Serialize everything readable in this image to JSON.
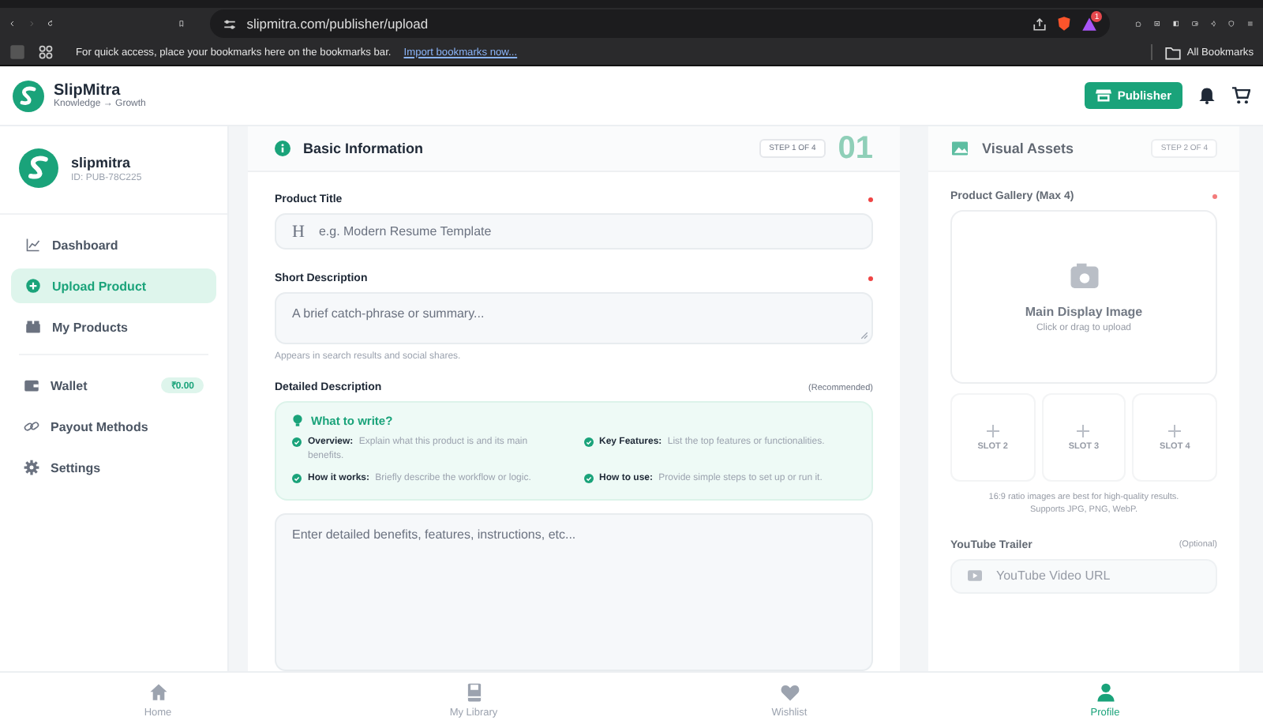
{
  "browser": {
    "url": "slipmitra.com/publisher/upload",
    "rewards_badge": "1",
    "bookmarks_hint": "For quick access, place your bookmarks here on the bookmarks bar.",
    "import_link": "Import bookmarks now...",
    "all_bookmarks": "All Bookmarks"
  },
  "header": {
    "brand": "SlipMitra",
    "tagline": "Knowledge → Growth",
    "publisher_button": "Publisher"
  },
  "profile": {
    "name": "slipmitra",
    "id": "ID: PUB-78C225"
  },
  "nav_groups": [
    [
      {
        "label": "Dashboard",
        "kind": "chart",
        "selected": false
      },
      {
        "label": "Upload Product",
        "kind": "plus",
        "selected": true
      },
      {
        "label": "My Products",
        "kind": "box",
        "selected": false
      }
    ],
    [
      {
        "label": "Wallet",
        "kind": "wallet",
        "selected": false,
        "badge": "₹0.00"
      },
      {
        "label": "Payout Methods",
        "kind": "link",
        "selected": false
      },
      {
        "label": "Settings",
        "kind": "gear",
        "selected": false
      }
    ]
  ],
  "basic_info": {
    "title": "Basic Information",
    "step": "STEP 1 OF 4",
    "step_number": "01",
    "product_title": {
      "label": "Product Title",
      "required": true,
      "icon": "H",
      "placeholder": "e.g. Modern Resume Template"
    },
    "short_description": {
      "label": "Short Description",
      "required": true,
      "placeholder": "A brief catch-phrase or summary...",
      "hint": "Appears in search results and social shares."
    },
    "detailed_description": {
      "label": "Detailed Description",
      "note": "(Recommended)",
      "guide_title": "What to write?",
      "guide_items": [
        {
          "term": "Overview:",
          "text": "Explain what this product is and its main benefits."
        },
        {
          "term": "Key Features:",
          "text": "List the top features or functionalities."
        },
        {
          "term": "How it works:",
          "text": "Briefly describe the workflow or logic."
        },
        {
          "term": "How to use:",
          "text": "Provide simple steps to set up or run it."
        }
      ],
      "placeholder": "Enter detailed benefits, features, instructions, etc..."
    }
  },
  "visual_assets": {
    "title": "Visual Assets",
    "step": "STEP 2 OF 4",
    "disabled": true,
    "gallery_label": "Product Gallery (Max 4)",
    "gallery_required": true,
    "main_image_title": "Main Display Image",
    "main_image_hint": "Click or drag to upload",
    "slots": [
      "SLOT 2",
      "SLOT 3",
      "SLOT 4"
    ],
    "ratio_note": "16:9 ratio images are best for high-quality results.",
    "formats_note": "Supports JPG, PNG, WebP.",
    "trailer_label": "YouTube Trailer",
    "trailer_note": "(Optional)",
    "trailer_placeholder": "YouTube Video URL"
  },
  "bottom_nav": [
    {
      "label": "Home",
      "kind": "home",
      "selected": false
    },
    {
      "label": "My Library",
      "kind": "book",
      "selected": false
    },
    {
      "label": "Wishlist",
      "kind": "heart",
      "selected": false
    },
    {
      "label": "Profile",
      "kind": "person",
      "selected": true
    }
  ]
}
